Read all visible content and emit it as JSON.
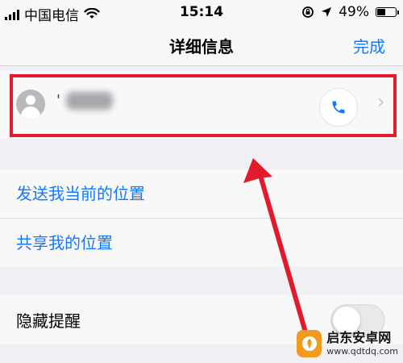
{
  "status_bar": {
    "carrier": "中国电信",
    "time": "15:14",
    "battery": "49%",
    "battery_level": 0.49,
    "icons": [
      "signal-icon",
      "wifi-icon",
      "lock-rotation-icon",
      "location-icon",
      "battery-icon"
    ]
  },
  "nav": {
    "title": "详细信息",
    "done": "完成"
  },
  "contact": {
    "name_visible": "'",
    "avatar_icon": "person-icon",
    "call_icon": "phone-icon",
    "chevron_icon": "chevron-right-icon"
  },
  "actions": [
    {
      "label": "发送我当前的位置"
    },
    {
      "label": "共享我的位置"
    }
  ],
  "hide_alerts": {
    "label": "隐藏提醒",
    "enabled": false
  },
  "watermark": {
    "title": "启东安卓网",
    "url": "www.qdtdq.com"
  },
  "colors": {
    "accent": "#1478ff",
    "highlight": "#e31a2b",
    "background": "#efeff4"
  }
}
